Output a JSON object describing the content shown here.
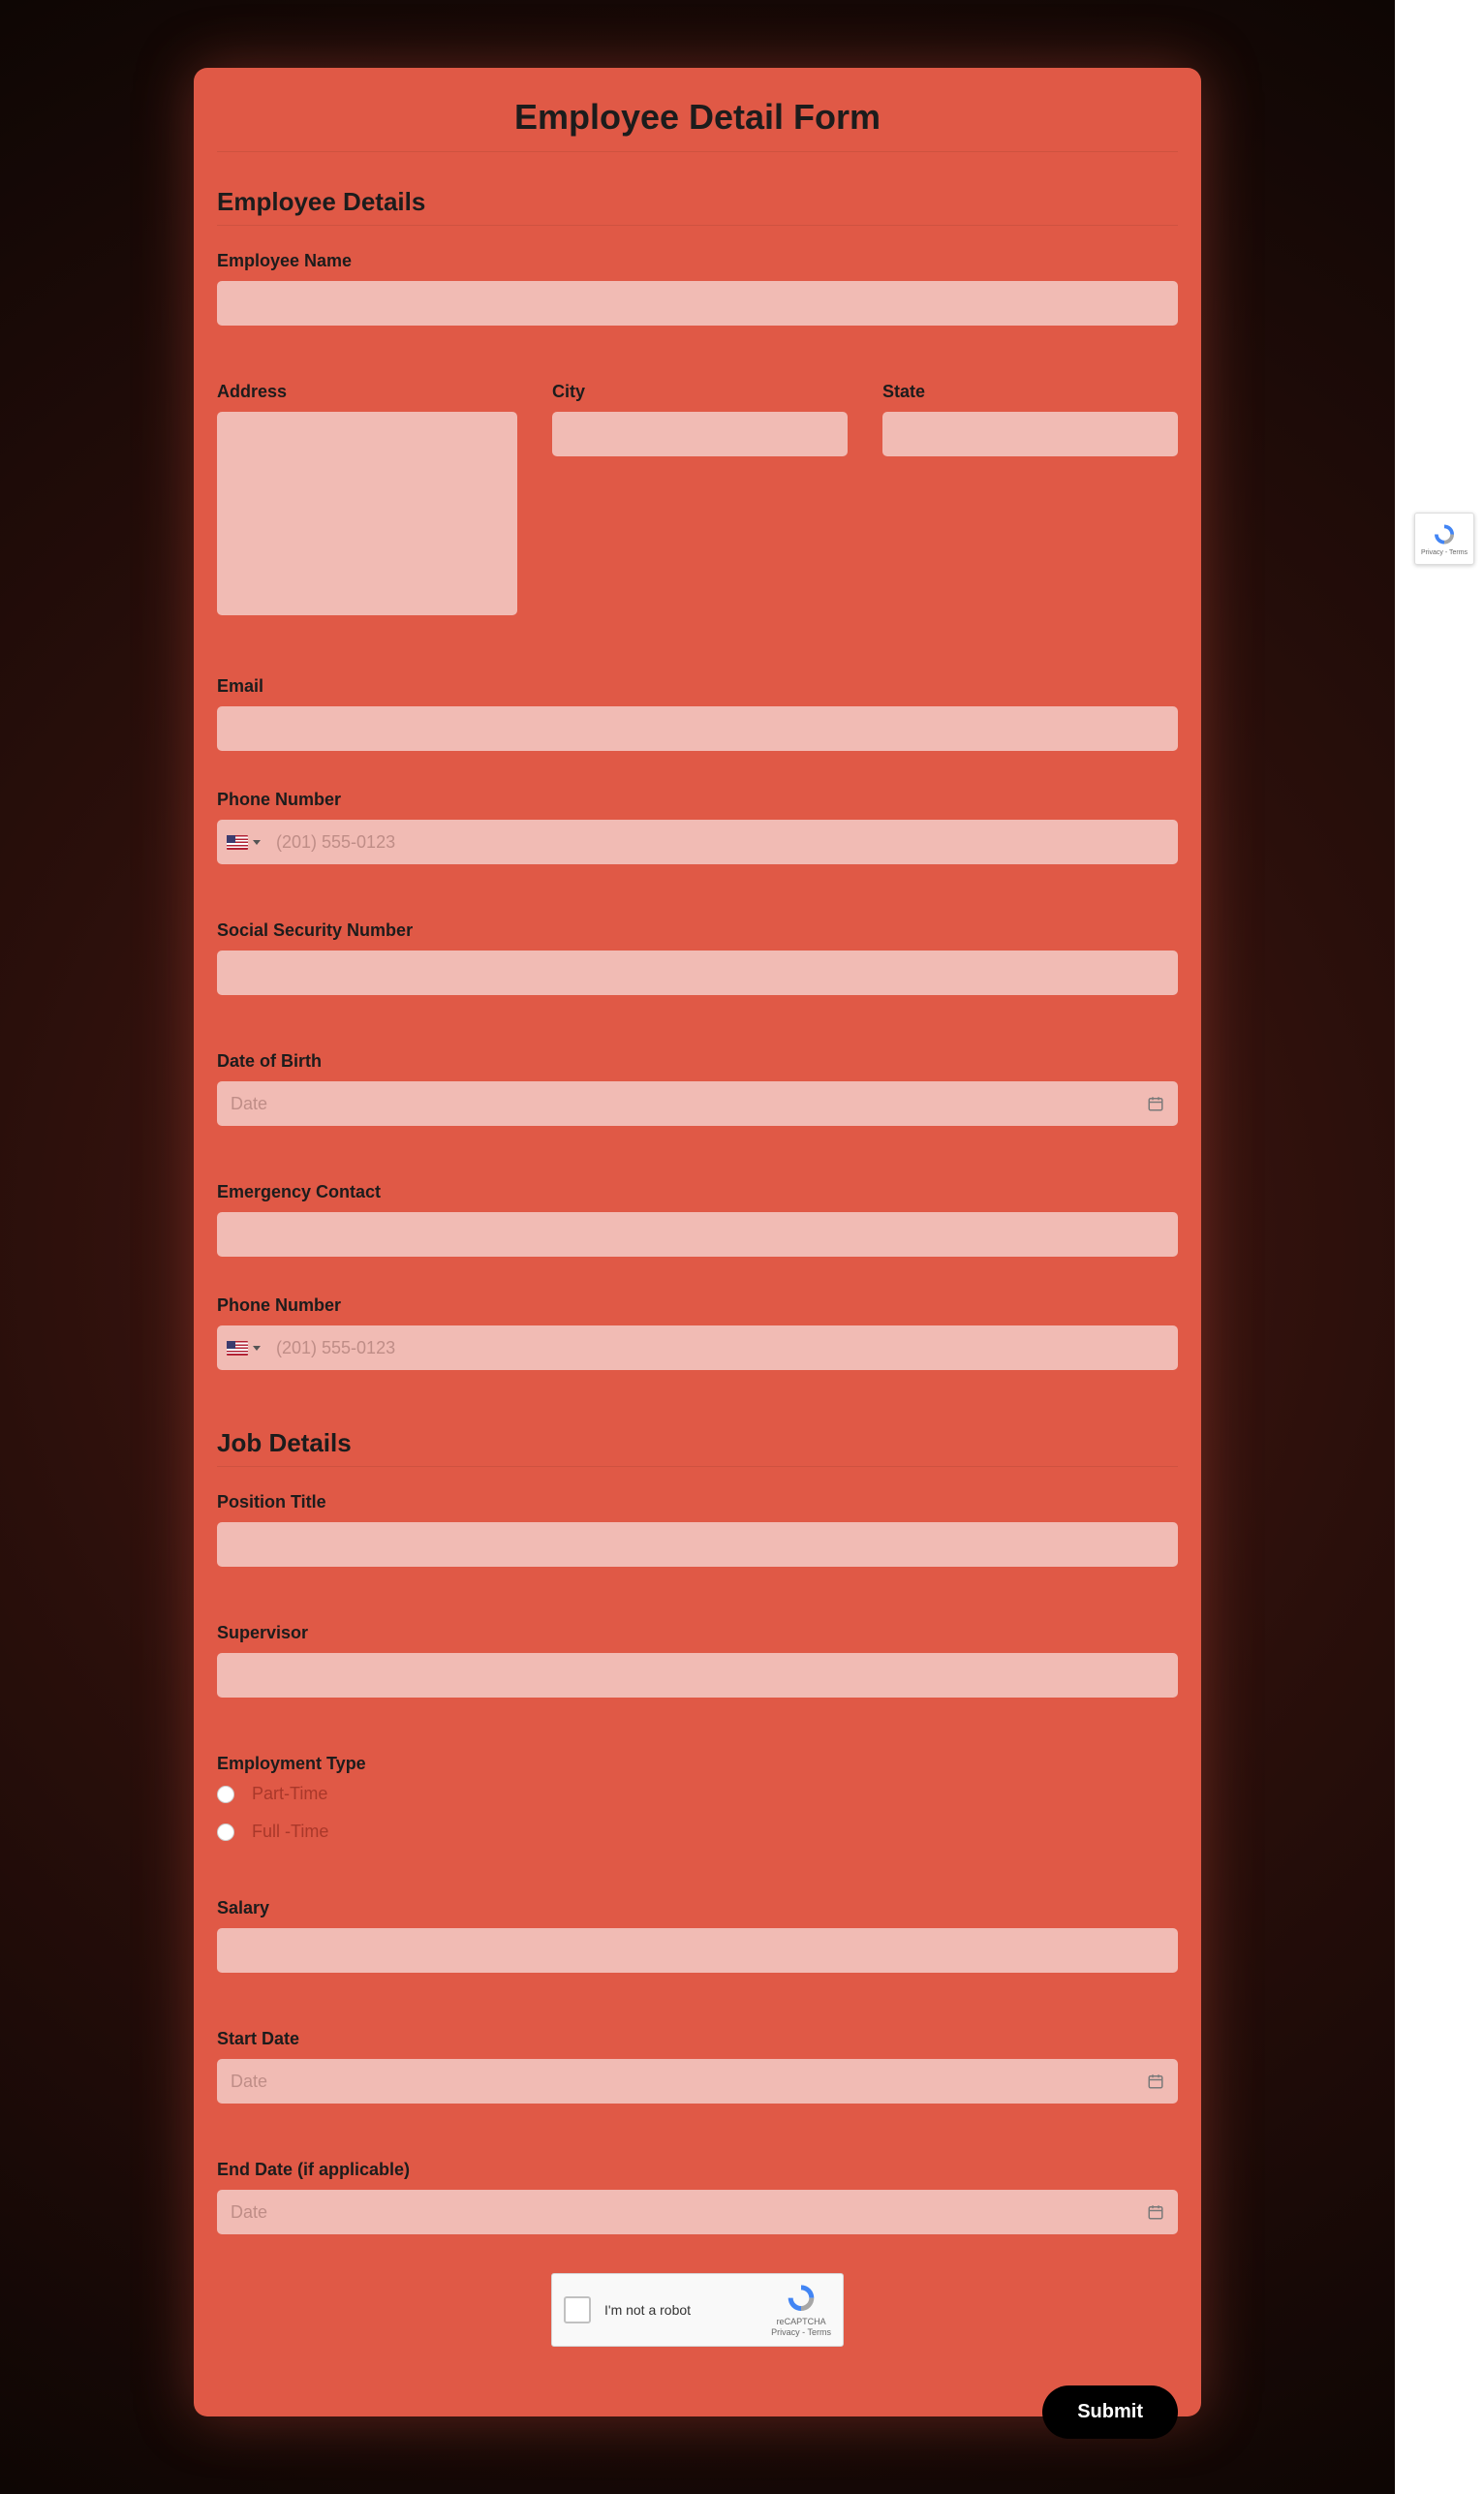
{
  "title": "Employee Detail Form",
  "section1": {
    "heading": "Employee Details",
    "employee_name": "Employee Name",
    "address": "Address",
    "city": "City",
    "state": "State",
    "email": "Email",
    "phone": "Phone Number",
    "phone_placeholder": "(201) 555-0123",
    "ssn": "Social Security Number",
    "dob": "Date of Birth",
    "date_placeholder": "Date",
    "emergency_contact": "Emergency Contact",
    "phone2": "Phone Number"
  },
  "section2": {
    "heading": "Job Details",
    "position_title": "Position Title",
    "supervisor": "Supervisor",
    "employment_type": "Employment Type",
    "option_part": "Part-Time",
    "option_full": "Full -Time",
    "salary": "Salary",
    "start_date": "Start Date",
    "end_date": "End Date (if applicable)"
  },
  "recaptcha": {
    "text": "I'm not a robot",
    "brand": "reCAPTCHA",
    "terms": "Privacy - Terms"
  },
  "submit": "Submit",
  "side_badge_terms": "Privacy - Terms"
}
